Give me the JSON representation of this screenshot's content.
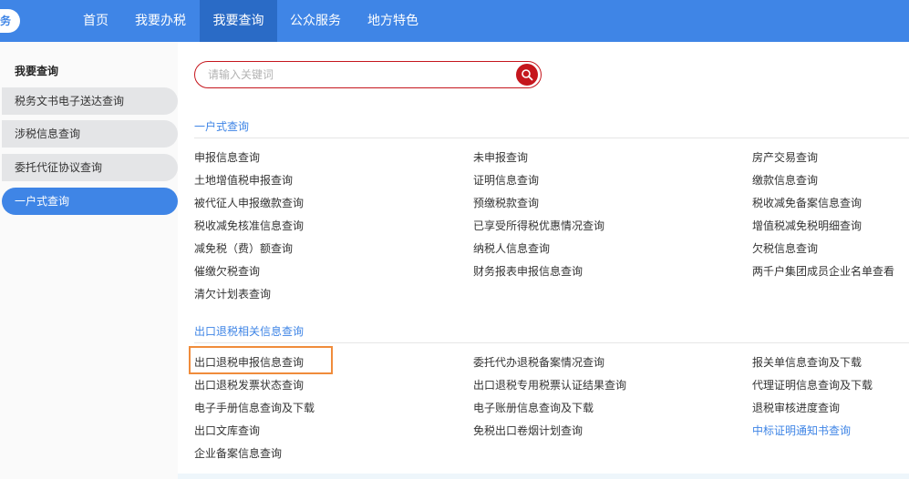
{
  "logo": {
    "mark": "务"
  },
  "topnav": {
    "items": [
      "首页",
      "我要办税",
      "我要查询",
      "公众服务",
      "地方特色"
    ],
    "active_index": 2
  },
  "sidebar": {
    "title": "我要查询",
    "items": [
      "税务文书电子送达查询",
      "涉税信息查询",
      "委托代征协议查询",
      "一户式查询"
    ],
    "active_index": 3
  },
  "search": {
    "placeholder": "请输入关键词",
    "value": ""
  },
  "sections": [
    {
      "title": "一户式查询",
      "links": [
        "申报信息查询",
        "未申报查询",
        "房产交易查询",
        "土地增值税申报查询",
        "证明信息查询",
        "缴款信息查询",
        "被代征人申报缴款查询",
        "预缴税款查询",
        "税收减免备案信息查询",
        "税收减免核准信息查询",
        "已享受所得税优惠情况查询",
        "增值税减免税明细查询",
        "减免税（费）额查询",
        "纳税人信息查询",
        "欠税信息查询",
        "催缴欠税查询",
        "财务报表申报信息查询",
        "两千户集团成员企业名单查看",
        "清欠计划表查询"
      ]
    },
    {
      "title": "出口退税相关信息查询",
      "links": [
        "出口退税申报信息查询",
        "委托代办退税备案情况查询",
        "报关单信息查询及下载",
        "出口退税发票状态查询",
        "出口退税专用税票认证结果查询",
        "代理证明信息查询及下载",
        "电子手册信息查询及下载",
        "电子账册信息查询及下载",
        "退税审核进度查询",
        "出口文库查询",
        "免税出口卷烟计划查询",
        "中标证明通知书查询",
        "企业备案信息查询"
      ],
      "highlighted_index": 0,
      "blue_index": 11
    }
  ],
  "colors": {
    "nav": "#3f85e6",
    "nav_active": "#2a6bc6",
    "search_border": "#c5161d",
    "link_blue": "#3f85e6",
    "highlight": "#f08c3b"
  }
}
